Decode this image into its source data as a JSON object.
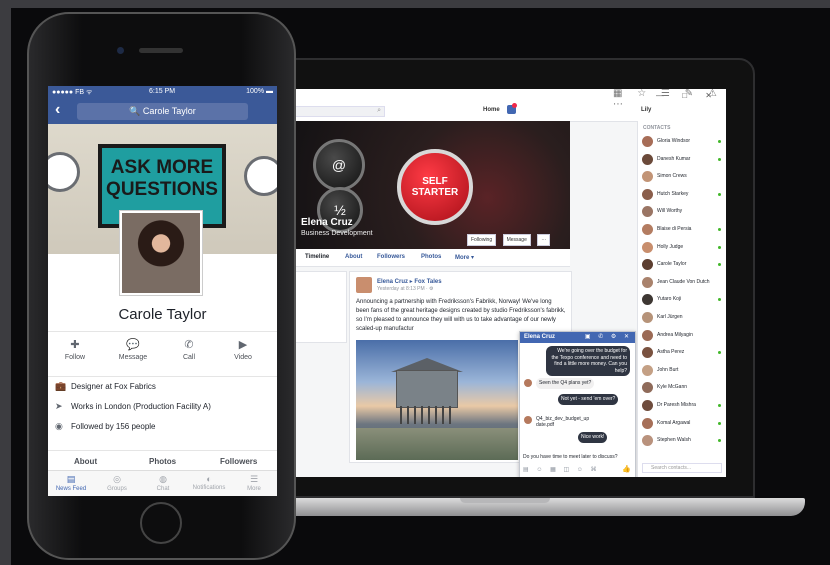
{
  "laptop": {
    "window_controls": "— □ ✕",
    "topbar": {
      "search_icon": "search-icon",
      "home_label": "Home",
      "user_label": "Lily"
    },
    "cover": {
      "name": "Elena Cruz",
      "title": "Business Development",
      "key_at": "@",
      "key_half": "½",
      "key_red": "SELF\nSTARTER",
      "following_label": "Following",
      "message_label": "Message",
      "more_label": "···"
    },
    "profile_tabs": [
      "Timeline",
      "About",
      "Followers",
      "Photos",
      "More ▾"
    ],
    "post": {
      "author_line": "Elena Cruz ▸ Fox Tales",
      "time": "Yesterday at 8:13 PM · ⚙",
      "text": "Announcing a partnership with Fredriksson's Fabrikk, Norway! We've long been fans of the great heritage designs created by studio Fredriksson's fabrikk, so I'm pleased to announce they will with us to take advantage of our newly scaled-up manufactur"
    },
    "chat": {
      "name": "Elena Cruz",
      "header_icons": "▣ ✆ ⚙ ✕",
      "messages": [
        {
          "dir": "out",
          "text": "We're going over the budget for the Texpo conference and need to find a little more money. Can you help?"
        },
        {
          "dir": "in",
          "text": "Seen the Q4 plans yet?"
        },
        {
          "dir": "out",
          "text": "Not yet - send 'em over?"
        },
        {
          "dir": "in",
          "text": "Q4_biz_dev_budget_up date.pdf"
        },
        {
          "dir": "out",
          "text": "Nice work!"
        },
        {
          "dir": "in",
          "text": "Do you have time to meet later to discuss?"
        }
      ],
      "tool_icons": "▤ ☺ ▦ ◫ ☺ ⌘",
      "like_icon": "👍"
    },
    "contacts": {
      "title": "CONTACTS",
      "search_placeholder": "Search contacts...",
      "items": [
        {
          "name": "Gloria Windsor",
          "online": true,
          "color": "#a76d57"
        },
        {
          "name": "Danesh Kumar",
          "online": true,
          "color": "#6b4a3a"
        },
        {
          "name": "Simon Crews",
          "online": false,
          "color": "#c29476"
        },
        {
          "name": "Hutch Starkey",
          "online": true,
          "color": "#8a5e4b"
        },
        {
          "name": "Will Worthy",
          "online": false,
          "color": "#9a7564"
        },
        {
          "name": "Blaise di Persia",
          "online": true,
          "color": "#b37c61"
        },
        {
          "name": "Holly Judge",
          "online": true,
          "color": "#c88e6d"
        },
        {
          "name": "Carole Taylor",
          "online": true,
          "color": "#5c3e30"
        },
        {
          "name": "Jean Claude Von Dutch",
          "online": false,
          "color": "#a9826c"
        },
        {
          "name": "Yutaro Koji",
          "online": true,
          "color": "#3e3733"
        },
        {
          "name": "Karl Jürgen",
          "online": false,
          "color": "#b69379"
        },
        {
          "name": "Andrea Milyagin",
          "online": false,
          "color": "#9b6a55"
        },
        {
          "name": "Astha Perez",
          "online": true,
          "color": "#7a5240"
        },
        {
          "name": "John Burt",
          "online": false,
          "color": "#c4a085"
        },
        {
          "name": "Kyle McGann",
          "online": false,
          "color": "#8f6b5a"
        },
        {
          "name": "Dr Paresh Mishra",
          "online": true,
          "color": "#6e4c3d"
        },
        {
          "name": "Komal Argawal",
          "online": true,
          "color": "#a66f58"
        },
        {
          "name": "Stephen Walsh",
          "online": true,
          "color": "#b9927d"
        }
      ]
    }
  },
  "phone": {
    "status": {
      "carrier": "●●●●● FB ᯤ",
      "time": "6:15 PM",
      "battery": "100% ▬"
    },
    "search_value": "🔍  Carole Taylor",
    "back_label": "‹",
    "sign_text": "ASK MORE\nQUESTIONS",
    "name": "Carole Taylor",
    "actions": [
      {
        "label": "Follow",
        "icon": "✚"
      },
      {
        "label": "Message",
        "icon": "💬"
      },
      {
        "label": "Call",
        "icon": "✆"
      },
      {
        "label": "Video",
        "icon": "▶"
      }
    ],
    "info": [
      {
        "icon": "💼",
        "text": "Designer at Fox Fabrics"
      },
      {
        "icon": "➤",
        "text": "Works in London (Production Facility A)"
      },
      {
        "icon": "◉",
        "text": "Followed by 156 people"
      }
    ],
    "subtabs": [
      "About",
      "Photos",
      "Followers"
    ],
    "tabbar": [
      {
        "label": "News Feed",
        "icon": "▤",
        "active": true
      },
      {
        "label": "Groups",
        "icon": "◎",
        "active": false
      },
      {
        "label": "Chat",
        "icon": "◍",
        "active": false
      },
      {
        "label": "Notifications",
        "icon": "◐",
        "active": false
      },
      {
        "label": "More",
        "icon": "☰",
        "active": false
      }
    ]
  }
}
